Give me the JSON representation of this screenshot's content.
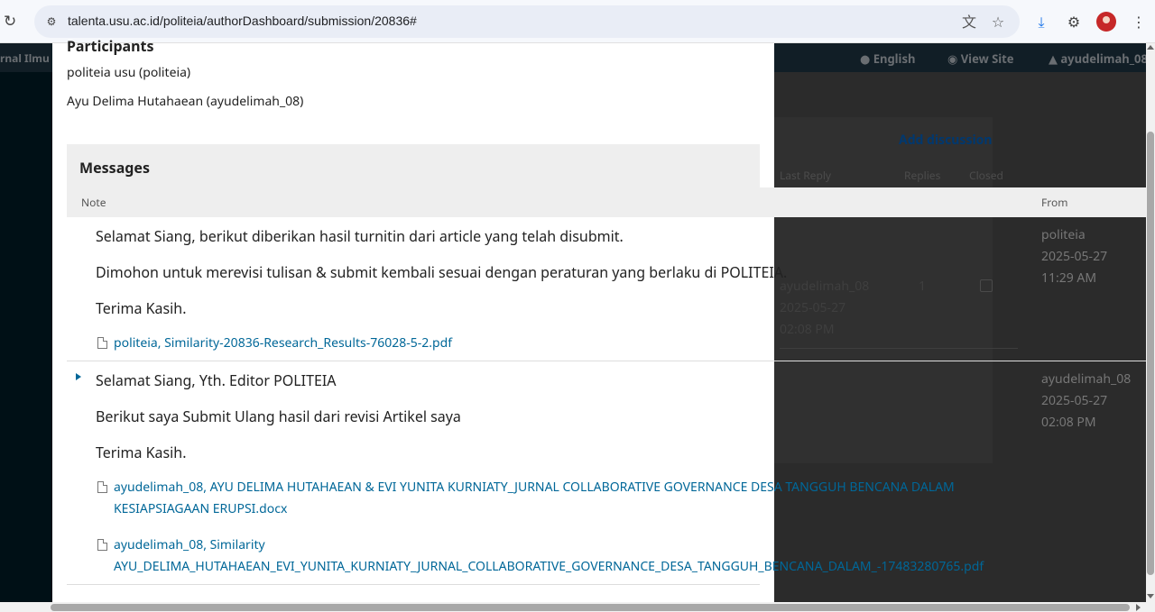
{
  "browser": {
    "url": "talenta.usu.ac.id/politeia/authorDashboard/submission/20836#"
  },
  "background": {
    "journal_name": "rnal Ilmu P",
    "nav": {
      "language": "English",
      "view_site": "View Site",
      "user": "ayudelimah_08"
    },
    "discussion": {
      "add_label": "Add discussion",
      "columns": [
        "Last Reply",
        "Replies",
        "Closed"
      ],
      "row": {
        "last_reply_user": "ayudelimah_08",
        "last_reply_date": "2025-05-27",
        "last_reply_time": "02:08 PM",
        "replies": "1"
      }
    }
  },
  "participants": {
    "title": "Participants",
    "users": [
      "politeia usu (politeia)",
      "Ayu Delima Hutahaean (ayudelimah_08)"
    ]
  },
  "messages": {
    "title": "Messages",
    "columns": {
      "note": "Note",
      "from": "From"
    },
    "items": [
      {
        "lines": [
          "Selamat Siang, berikut diberikan hasil turnitin dari article yang telah disubmit.",
          "Dimohon untuk merevisi tulisan & submit kembali sesuai dengan peraturan yang berlaku di POLITEIA.",
          "Terima Kasih."
        ],
        "files": [
          "politeia, Similarity-20836-Research_Results-76028-5-2.pdf"
        ],
        "from_user": "politeia",
        "from_date": "2025-05-27",
        "from_time": "11:29 AM"
      },
      {
        "lines": [
          "Selamat Siang, Yth. Editor POLITEIA",
          "Berikut saya Submit Ulang hasil dari revisi Artikel saya",
          "Terima Kasih."
        ],
        "files": [
          "ayudelimah_08, AYU DELIMA HUTAHAEAN & EVI YUNITA KURNIATY_JURNAL COLLABORATIVE GOVERNANCE DESA TANGGUH BENCANA DALAM KESIAPSIAGAAN ERUPSI.docx",
          "ayudelimah_08, Similarity AYU_DELIMA_HUTAHAEAN_EVI_YUNITA_KURNIATY_JURNAL_COLLABORATIVE_GOVERNANCE_DESA_TANGGUH_BENCANA_DALAM_-17483280765.pdf"
        ],
        "from_user": "ayudelimah_08",
        "from_date": "2025-05-27",
        "from_time": "02:08 PM"
      }
    ]
  }
}
